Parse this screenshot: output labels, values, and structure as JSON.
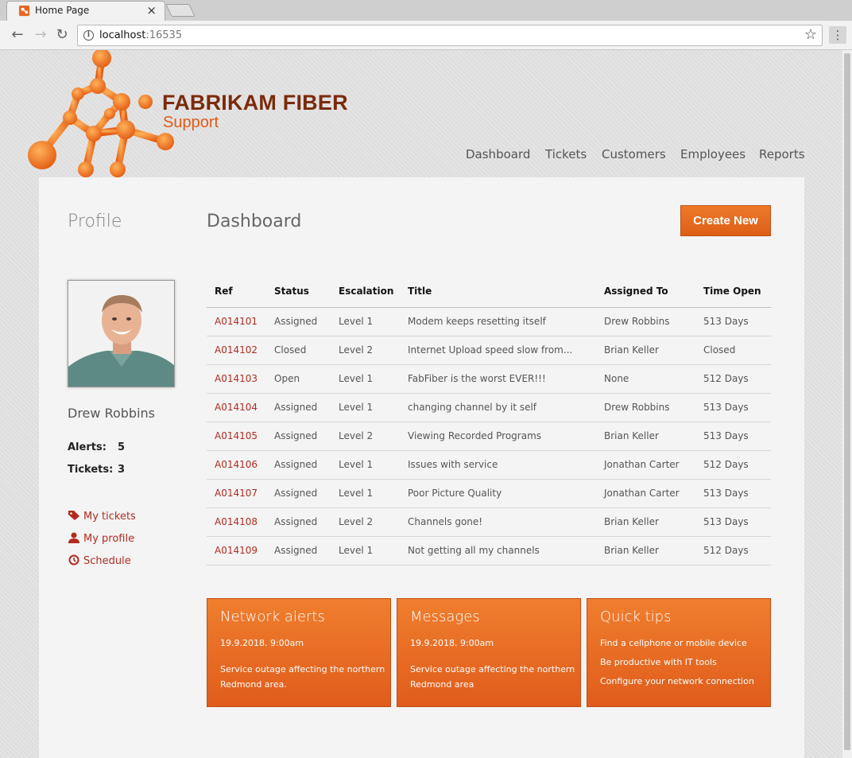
{
  "browser": {
    "tab_title": "Home Page",
    "url_host": "localhost",
    "url_port": ":16535"
  },
  "site": {
    "brand_name": "FABRIKAM FIBER",
    "brand_sub": "Support",
    "nav": [
      "Dashboard",
      "Tickets",
      "Customers",
      "Employees",
      "Reports"
    ]
  },
  "profile": {
    "heading": "Profile",
    "name": "Drew Robbins",
    "alerts_label": "Alerts:",
    "alerts_value": "5",
    "tickets_label": "Tickets:",
    "tickets_value": "3",
    "links": [
      "My tickets",
      "My profile",
      "Schedule"
    ]
  },
  "dashboard": {
    "heading": "Dashboard",
    "create_label": "Create New",
    "columns": [
      "Ref",
      "Status",
      "Escalation",
      "Title",
      "Assigned To",
      "Time Open"
    ],
    "rows": [
      [
        "A014101",
        "Assigned",
        "Level 1",
        "Modem keeps resetting itself",
        "Drew Robbins",
        "513 Days"
      ],
      [
        "A014102",
        "Closed",
        "Level 2",
        "Internet Upload speed slow from...",
        "Brian Keller",
        "Closed"
      ],
      [
        "A014103",
        "Open",
        "Level 1",
        "FabFiber is the worst EVER!!!",
        "None",
        "512 Days"
      ],
      [
        "A014104",
        "Assigned",
        "Level 1",
        "changing channel by it self",
        "Drew Robbins",
        "513 Days"
      ],
      [
        "A014105",
        "Assigned",
        "Level 2",
        "Viewing Recorded Programs",
        "Brian Keller",
        "513 Days"
      ],
      [
        "A014106",
        "Assigned",
        "Level 1",
        "Issues with service",
        "Jonathan Carter",
        "512 Days"
      ],
      [
        "A014107",
        "Assigned",
        "Level 1",
        "Poor Picture Quality",
        "Jonathan Carter",
        "513 Days"
      ],
      [
        "A014108",
        "Assigned",
        "Level 2",
        "Channels gone!",
        "Brian Keller",
        "513 Days"
      ],
      [
        "A014109",
        "Assigned",
        "Level 1",
        "Not getting all my channels",
        "Brian Keller",
        "512 Days"
      ]
    ]
  },
  "cards": {
    "network": {
      "title": "Network alerts",
      "date": "19.9.2018. 9:00am",
      "body": "Service outage affecting the northern Redmond area."
    },
    "messages": {
      "title": "Messages",
      "date": "19.9.2018. 9:00am",
      "body": "Service outage affecting the northern Redmond area"
    },
    "tips": {
      "title": "Quick tips",
      "items": [
        "Find a cellphone or mobile device",
        "Be productive with IT tools",
        "Configure your network connection"
      ]
    }
  },
  "colors": {
    "accent": "#e8661f",
    "link": "#b22b1f",
    "brand_dark": "#7a2b0c"
  },
  "icons": [
    "favicon-icon",
    "close-icon",
    "back-icon",
    "forward-icon",
    "reload-icon",
    "info-icon",
    "star-icon",
    "menu-icon",
    "tag-icon",
    "user-icon",
    "clock-icon"
  ]
}
